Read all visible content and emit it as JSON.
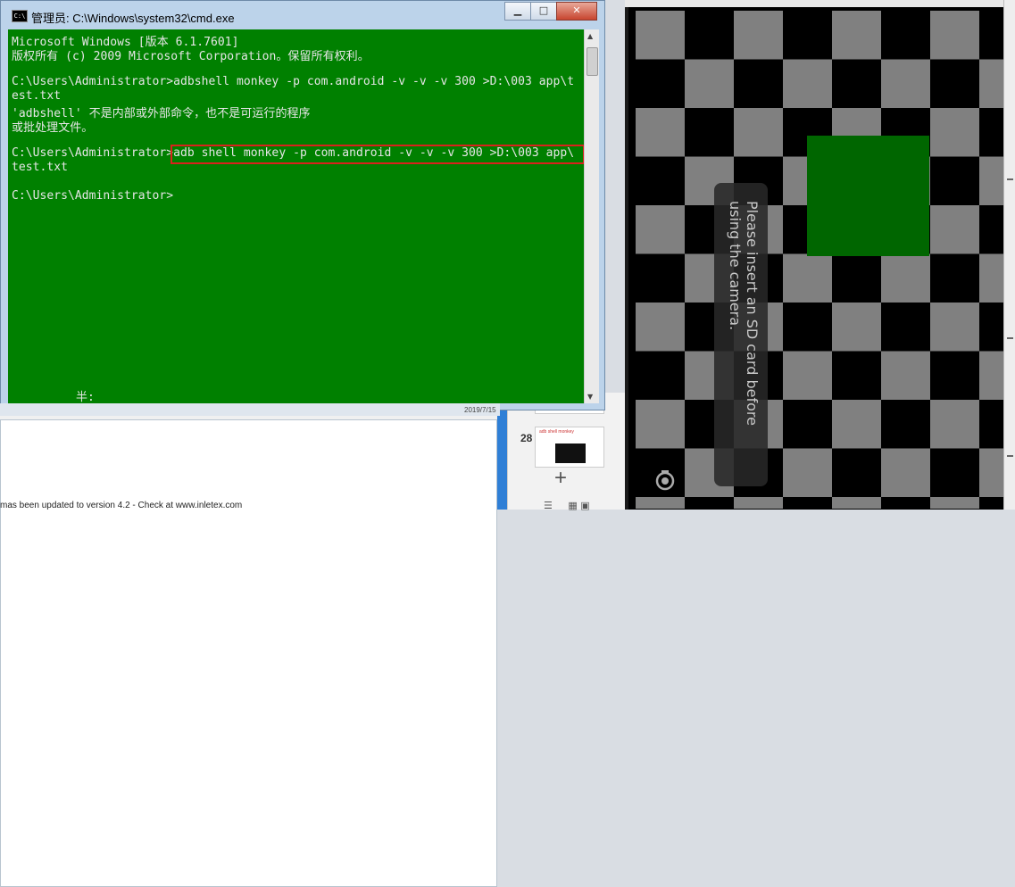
{
  "cmd": {
    "title": "管理员: C:\\Windows\\system32\\cmd.exe",
    "icon": "cmd-icon",
    "icon_label": "C:\\",
    "buttons": {
      "minimize": "▁",
      "maximize": "□",
      "close": "✕"
    },
    "lines": [
      "Microsoft Windows [版本 6.1.7601]",
      "版权所有 (c) 2009 Microsoft Corporation。保留所有权利。",
      "",
      "C:\\Users\\Administrator>adbshell monkey -p com.android -v -v -v 300 >D:\\003 app\\t",
      "est.txt",
      "'adbshell' 不是内部或外部命令，也不是可运行的程序",
      "或批处理文件。",
      "",
      "C:\\Users\\Administrator>adb shell monkey -p com.android -v -v -v 300 >D:\\003 app\\",
      "test.txt",
      "",
      "C:\\Users\\Administrator>"
    ],
    "ime_status": "半:",
    "console_color": "#008000",
    "highlight_color": "#d9221c"
  },
  "background": {
    "status_text": "mas been updated to version 4.2 - Check at www.inletex.com",
    "taskbar_date": "2019/7/15",
    "thumb_number": "28",
    "thumb_caption": "adb shell monkey",
    "add_label": "+"
  },
  "emulator": {
    "toast": "Please insert an SD card before using the camera.",
    "board_dark": "#000000",
    "board_light": "#808080",
    "green": "#006600",
    "camera_icon": "camera-switch-icon"
  }
}
